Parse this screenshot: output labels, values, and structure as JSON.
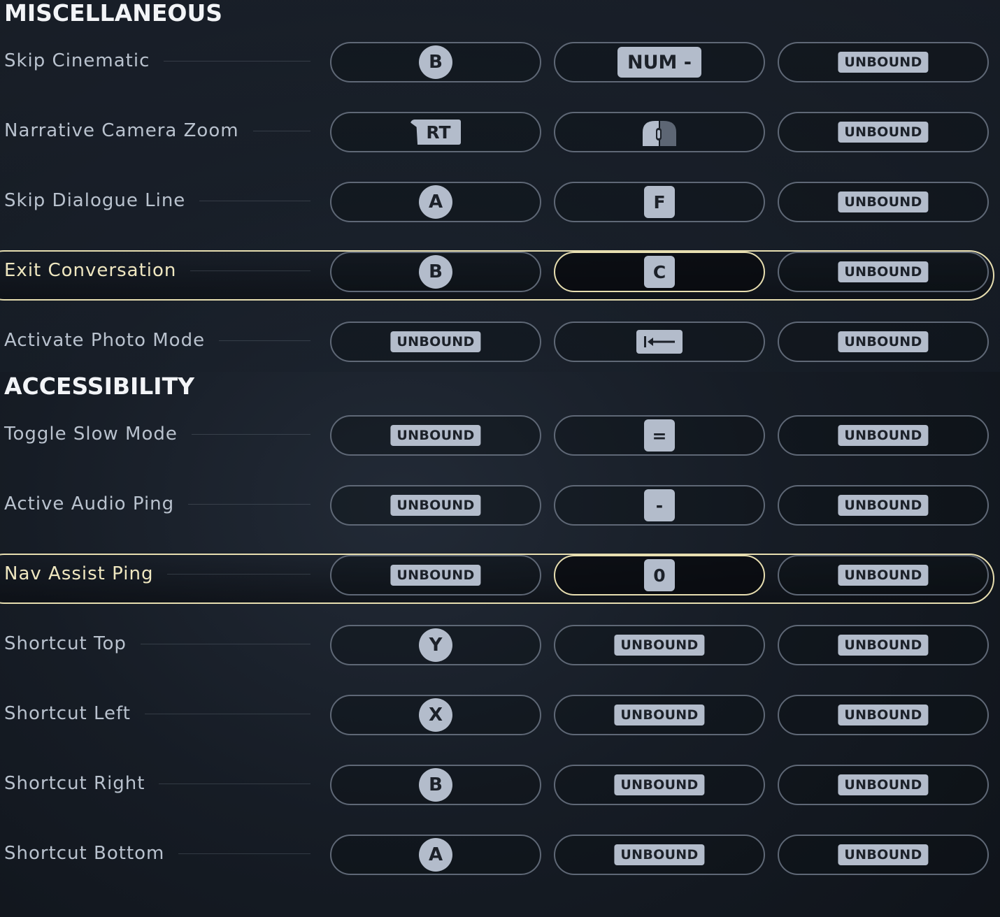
{
  "sections": [
    {
      "title": "MISCELLANEOUS",
      "rows": [
        {
          "label": "Skip Cinematic",
          "selected": false,
          "active_slot": null,
          "bindings": [
            {
              "type": "circle",
              "text": "B",
              "icon": "gamepad-b-button"
            },
            {
              "type": "keywide",
              "text": "NUM -",
              "icon": "keyboard-num-minus-key"
            },
            {
              "type": "tag",
              "text": "UNBOUND",
              "icon": "unbound-tag"
            }
          ]
        },
        {
          "label": "Narrative Camera Zoom",
          "selected": false,
          "active_slot": null,
          "bindings": [
            {
              "type": "trigger",
              "text": "RT",
              "icon": "gamepad-rt-trigger"
            },
            {
              "type": "mouse",
              "text": "",
              "icon": "mouse-right-button-icon"
            },
            {
              "type": "tag",
              "text": "UNBOUND",
              "icon": "unbound-tag"
            }
          ]
        },
        {
          "label": "Skip Dialogue Line",
          "selected": false,
          "active_slot": null,
          "bindings": [
            {
              "type": "circle",
              "text": "A",
              "icon": "gamepad-a-button"
            },
            {
              "type": "key",
              "text": "F",
              "icon": "keyboard-f-key"
            },
            {
              "type": "tag",
              "text": "UNBOUND",
              "icon": "unbound-tag"
            }
          ]
        },
        {
          "label": "Exit Conversation",
          "selected": true,
          "active_slot": 1,
          "bindings": [
            {
              "type": "circle",
              "text": "B",
              "icon": "gamepad-b-button"
            },
            {
              "type": "key",
              "text": "C",
              "icon": "keyboard-c-key"
            },
            {
              "type": "tag",
              "text": "UNBOUND",
              "icon": "unbound-tag"
            }
          ]
        },
        {
          "label": "Activate Photo Mode",
          "selected": false,
          "active_slot": null,
          "bindings": [
            {
              "type": "tag",
              "text": "UNBOUND",
              "icon": "unbound-tag"
            },
            {
              "type": "backtab",
              "text": "",
              "icon": "keyboard-tab-key-icon"
            },
            {
              "type": "tag",
              "text": "UNBOUND",
              "icon": "unbound-tag"
            }
          ]
        }
      ]
    },
    {
      "title": "ACCESSIBILITY",
      "rows": [
        {
          "label": "Toggle Slow Mode",
          "selected": false,
          "active_slot": null,
          "bindings": [
            {
              "type": "tag",
              "text": "UNBOUND",
              "icon": "unbound-tag"
            },
            {
              "type": "key",
              "text": "=",
              "icon": "keyboard-equals-key"
            },
            {
              "type": "tag",
              "text": "UNBOUND",
              "icon": "unbound-tag"
            }
          ]
        },
        {
          "label": "Active Audio Ping",
          "selected": false,
          "active_slot": null,
          "bindings": [
            {
              "type": "tag",
              "text": "UNBOUND",
              "icon": "unbound-tag"
            },
            {
              "type": "key",
              "text": "-",
              "icon": "keyboard-minus-key"
            },
            {
              "type": "tag",
              "text": "UNBOUND",
              "icon": "unbound-tag"
            }
          ]
        },
        {
          "label": "Nav Assist Ping",
          "selected": true,
          "active_slot": 1,
          "bindings": [
            {
              "type": "tag",
              "text": "UNBOUND",
              "icon": "unbound-tag"
            },
            {
              "type": "key",
              "text": "0",
              "icon": "keyboard-0-key"
            },
            {
              "type": "tag",
              "text": "UNBOUND",
              "icon": "unbound-tag"
            }
          ]
        },
        {
          "label": "Shortcut Top",
          "selected": false,
          "active_slot": null,
          "bindings": [
            {
              "type": "circle",
              "text": "Y",
              "icon": "gamepad-y-button"
            },
            {
              "type": "tag",
              "text": "UNBOUND",
              "icon": "unbound-tag"
            },
            {
              "type": "tag",
              "text": "UNBOUND",
              "icon": "unbound-tag"
            }
          ]
        },
        {
          "label": "Shortcut Left",
          "selected": false,
          "active_slot": null,
          "bindings": [
            {
              "type": "circle",
              "text": "X",
              "icon": "gamepad-x-button"
            },
            {
              "type": "tag",
              "text": "UNBOUND",
              "icon": "unbound-tag"
            },
            {
              "type": "tag",
              "text": "UNBOUND",
              "icon": "unbound-tag"
            }
          ]
        },
        {
          "label": "Shortcut Right",
          "selected": false,
          "active_slot": null,
          "bindings": [
            {
              "type": "circle",
              "text": "B",
              "icon": "gamepad-b-button"
            },
            {
              "type": "tag",
              "text": "UNBOUND",
              "icon": "unbound-tag"
            },
            {
              "type": "tag",
              "text": "UNBOUND",
              "icon": "unbound-tag"
            }
          ]
        },
        {
          "label": "Shortcut Bottom",
          "selected": false,
          "active_slot": null,
          "bindings": [
            {
              "type": "circle",
              "text": "A",
              "icon": "gamepad-a-button"
            },
            {
              "type": "tag",
              "text": "UNBOUND",
              "icon": "unbound-tag"
            },
            {
              "type": "tag",
              "text": "UNBOUND",
              "icon": "unbound-tag"
            }
          ]
        }
      ]
    }
  ],
  "colors": {
    "accent": "#e7deb0",
    "glyph": "#b3bccb",
    "slot_border": "#5f6876",
    "label": "#b9c2ce",
    "title": "#f2f4f7"
  }
}
